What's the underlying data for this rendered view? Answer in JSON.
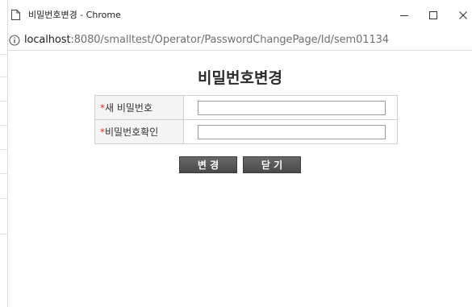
{
  "window": {
    "title": "비밀번호변경 - Chrome",
    "minimize_glyph": "—",
    "maximize_glyph": "☐",
    "close_glyph": "✕"
  },
  "address_bar": {
    "host": "localhost",
    "path": ":8080/smalltest/Operator/PasswordChangePage/Id/sem01134",
    "icon": "info-icon"
  },
  "page": {
    "title": "비밀번호변경"
  },
  "form": {
    "required_mark": "*",
    "new_password_label": "새 비밀번호",
    "new_password_value": "",
    "confirm_password_label": "비밀번호확인",
    "confirm_password_value": ""
  },
  "buttons": {
    "change_label": "변 경",
    "close_label": "닫 기"
  },
  "colors": {
    "required": "#e0302a",
    "button_bg": "#555555"
  }
}
